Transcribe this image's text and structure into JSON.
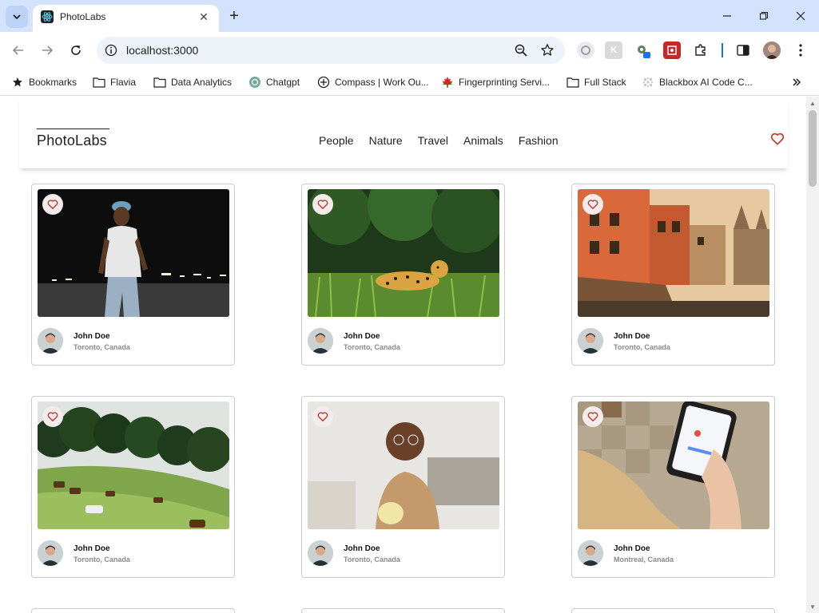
{
  "browser": {
    "tab_title": "PhotoLabs",
    "url": "localhost:3000",
    "bookmarks": [
      {
        "label": "Bookmarks",
        "icon": "star-icon"
      },
      {
        "label": "Flavia",
        "icon": "folder-icon"
      },
      {
        "label": "Data Analytics",
        "icon": "folder-icon"
      },
      {
        "label": "Chatgpt",
        "icon": "chatgpt-icon"
      },
      {
        "label": "Compass | Work Ou...",
        "icon": "compass-icon"
      },
      {
        "label": "Fingerprinting Servi...",
        "icon": "maple-leaf-icon"
      },
      {
        "label": "Full Stack",
        "icon": "folder-icon"
      },
      {
        "label": "Blackbox AI Code C...",
        "icon": "blackbox-icon"
      }
    ]
  },
  "app": {
    "logo": "PhotoLabs",
    "topics": [
      "People",
      "Nature",
      "Travel",
      "Animals",
      "Fashion"
    ],
    "accent_color": "#c0392b"
  },
  "photos": [
    {
      "name": "John Doe",
      "location": "Toronto, Canada",
      "scene": "man-street-night"
    },
    {
      "name": "John Doe",
      "location": "Toronto, Canada",
      "scene": "jaguar-grass"
    },
    {
      "name": "John Doe",
      "location": "Toronto, Canada",
      "scene": "old-city-buildings"
    },
    {
      "name": "John Doe",
      "location": "Toronto, Canada",
      "scene": "horses-hillside"
    },
    {
      "name": "John Doe",
      "location": "Toronto, Canada",
      "scene": "man-coffee-sofa"
    },
    {
      "name": "John Doe",
      "location": "Montreal, Canada",
      "scene": "phone-in-hand"
    }
  ]
}
